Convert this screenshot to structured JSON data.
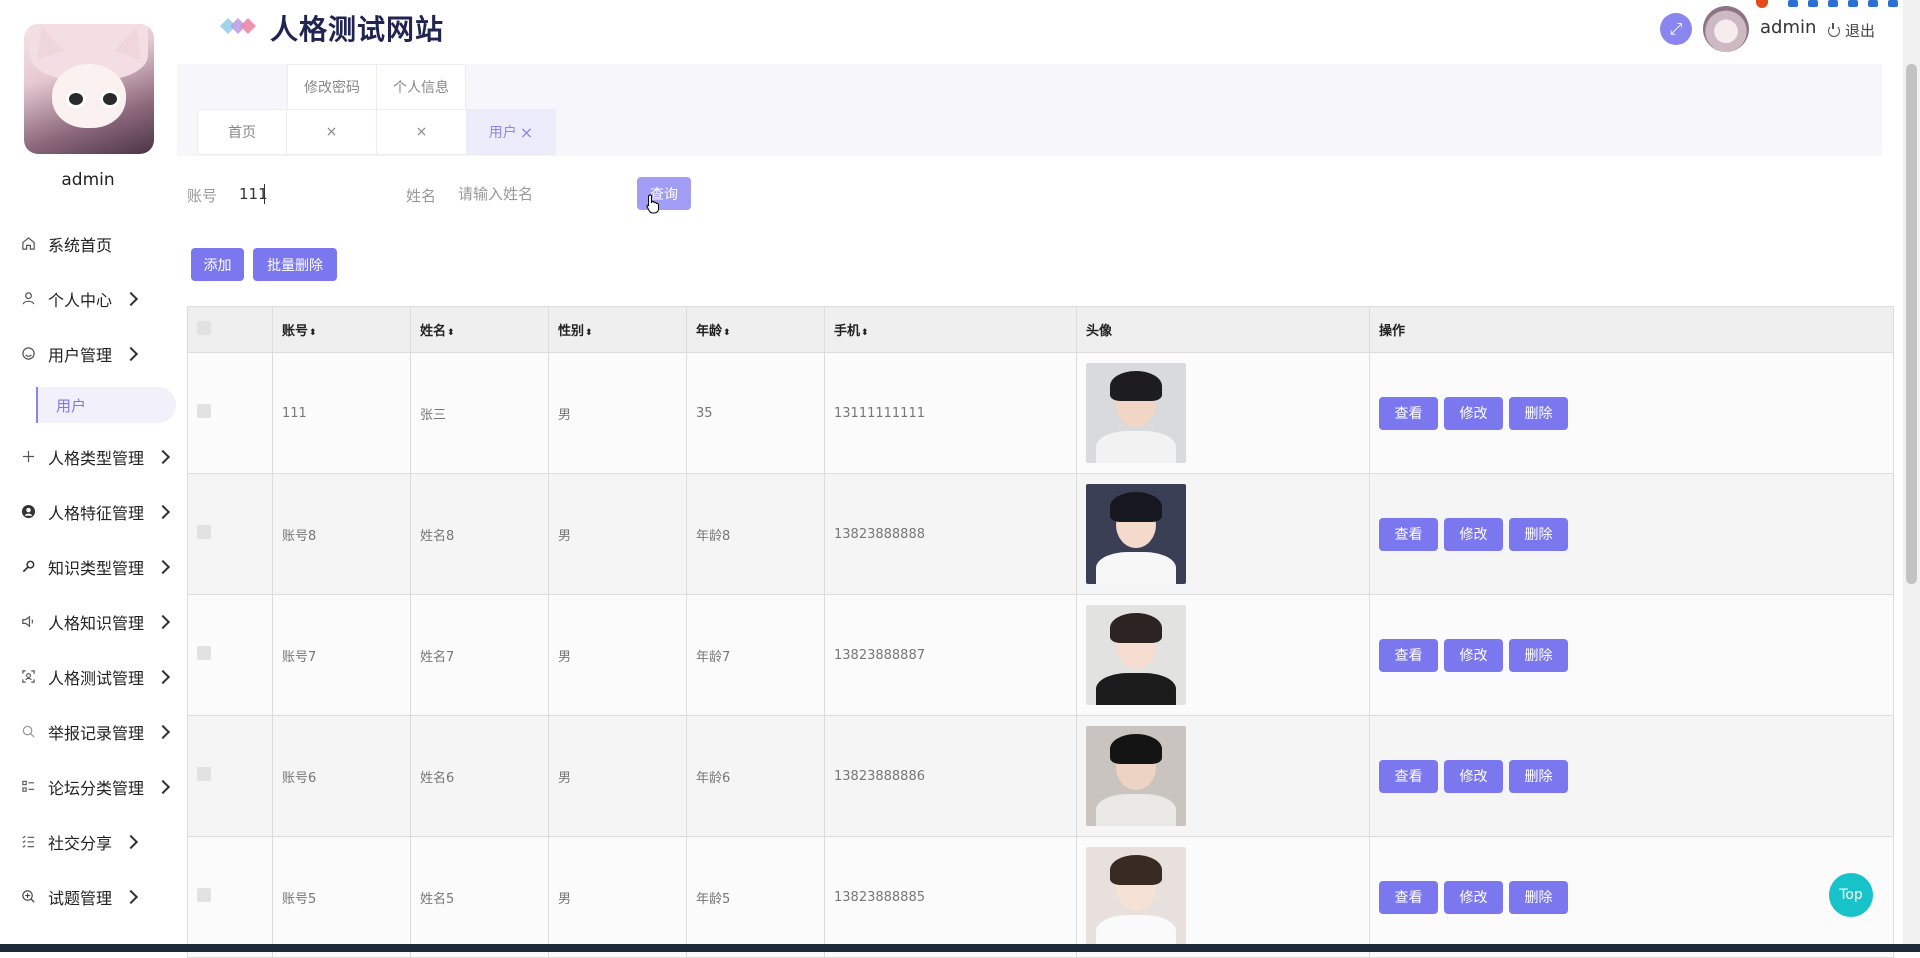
{
  "header": {
    "title": "人格测试网站",
    "username": "admin",
    "logout_label": "退出"
  },
  "sidebar": {
    "username": "admin",
    "items": [
      {
        "label": "系统首页",
        "icon": "home-icon",
        "chevron": false
      },
      {
        "label": "个人中心",
        "icon": "user-icon",
        "chevron": true
      },
      {
        "label": "用户管理",
        "icon": "smile-icon",
        "chevron": true
      },
      {
        "label": "人格类型管理",
        "icon": "plus-icon",
        "chevron": true
      },
      {
        "label": "人格特征管理",
        "icon": "user-circle-icon",
        "chevron": true
      },
      {
        "label": "知识类型管理",
        "icon": "key-icon",
        "chevron": true
      },
      {
        "label": "人格知识管理",
        "icon": "speaker-icon",
        "chevron": true
      },
      {
        "label": "人格测试管理",
        "icon": "scan-icon",
        "chevron": true
      },
      {
        "label": "举报记录管理",
        "icon": "search-icon",
        "chevron": true
      },
      {
        "label": "论坛分类管理",
        "icon": "list-icon",
        "chevron": true
      },
      {
        "label": "社交分享",
        "icon": "list-check-icon",
        "chevron": true
      },
      {
        "label": "试题管理",
        "icon": "zoom-icon",
        "chevron": true
      }
    ],
    "submenu_active": "用户"
  },
  "tabs": {
    "row1": [
      "修改密码",
      "个人信息"
    ],
    "home": "首页",
    "close_glyph": "×",
    "active": "用户"
  },
  "search": {
    "account_label": "账号",
    "account_value": "111",
    "name_label": "姓名",
    "name_placeholder": "请输入姓名",
    "query_button": "查询"
  },
  "actions": {
    "add": "添加",
    "batch_delete": "批量删除"
  },
  "table": {
    "columns": [
      "账号",
      "姓名",
      "性别",
      "年龄",
      "手机",
      "头像",
      "操作"
    ],
    "sort_glyph": "⬍",
    "op_buttons": [
      "查看",
      "修改",
      "删除"
    ],
    "rows": [
      {
        "account": "111",
        "name": "张三",
        "gender": "男",
        "age": "35",
        "phone": "13111111111",
        "photo": {
          "bg": "#d8dadc",
          "skin": "#f1d6c6",
          "hair": "#1d1d1f",
          "cloth": "#f2f2f2"
        }
      },
      {
        "account": "账号8",
        "name": "姓名8",
        "gender": "男",
        "age": "年龄8",
        "phone": "13823888888",
        "photo": {
          "bg": "#3a3f55",
          "skin": "#f3dacb",
          "hair": "#16171f",
          "cloth": "#f7f7f7"
        }
      },
      {
        "account": "账号7",
        "name": "姓名7",
        "gender": "男",
        "age": "年龄7",
        "phone": "13823888887",
        "photo": {
          "bg": "#e2e2e0",
          "skin": "#f5ddd2",
          "hair": "#2b2423",
          "cloth": "#1c1c1c"
        }
      },
      {
        "account": "账号6",
        "name": "姓名6",
        "gender": "男",
        "age": "年龄6",
        "phone": "13823888886",
        "photo": {
          "bg": "#c9c4bf",
          "skin": "#ecd3c3",
          "hair": "#141414",
          "cloth": "#ebe9e6"
        }
      },
      {
        "account": "账号5",
        "name": "姓名5",
        "gender": "男",
        "age": "年龄5",
        "phone": "13823888885",
        "photo": {
          "bg": "#e8e0dd",
          "skin": "#f6e1d6",
          "hair": "#3a2a24",
          "cloth": "#fafafa"
        }
      }
    ]
  },
  "top_button": "Top",
  "colors": {
    "accent": "#7b77ef",
    "top_button": "#17c2c9"
  }
}
